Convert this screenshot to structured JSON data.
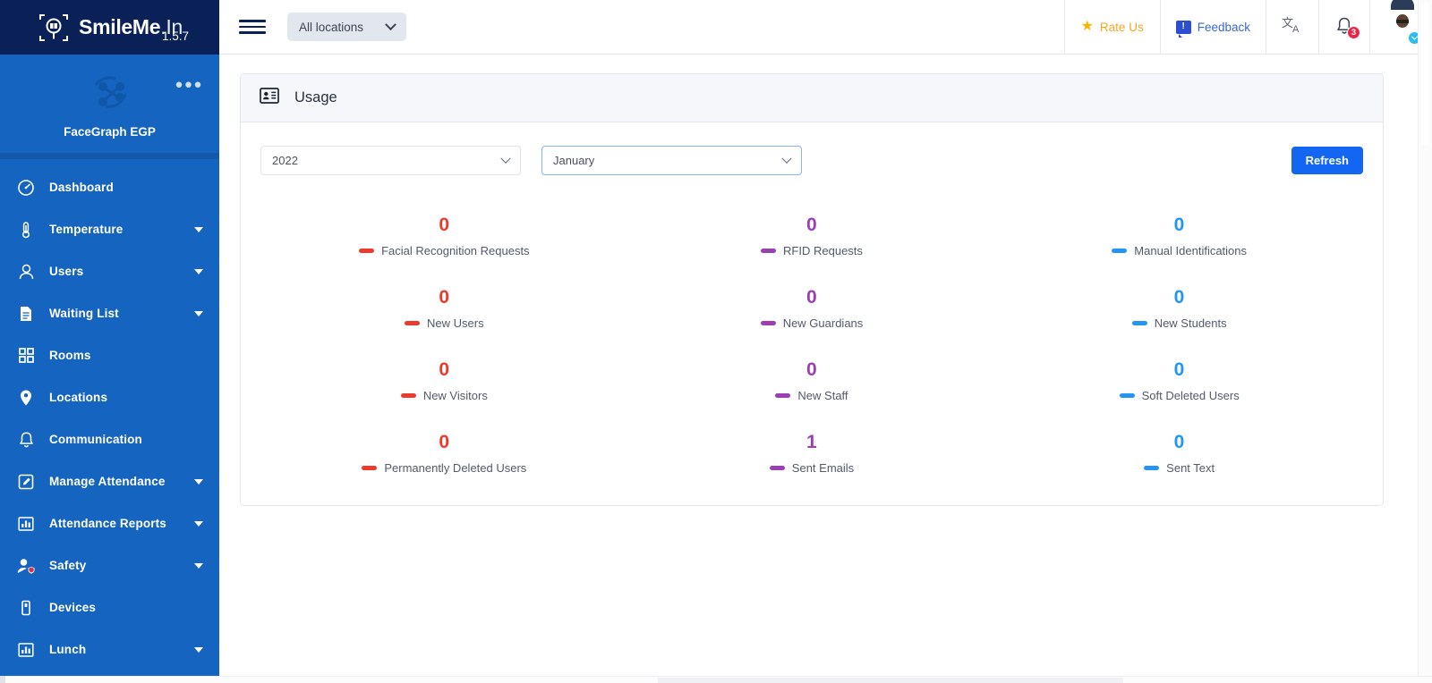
{
  "brand": {
    "name_bold": "SmileMe",
    "name_rest": ".In",
    "version": "1.5.7",
    "logo_icon": "face-scan-logo-icon"
  },
  "tenant": {
    "name": "FaceGraph EGP",
    "menu_icon": "ellipsis-icon",
    "logo_icon": "network-graph-icon"
  },
  "sidebar": {
    "items": [
      {
        "label": "Dashboard",
        "icon": "speedometer-icon",
        "expandable": false
      },
      {
        "label": "Temperature",
        "icon": "thermometer-icon",
        "expandable": true
      },
      {
        "label": "Users",
        "icon": "user-icon",
        "expandable": true
      },
      {
        "label": "Waiting List",
        "icon": "document-icon",
        "expandable": true
      },
      {
        "label": "Rooms",
        "icon": "grid-squares-icon",
        "expandable": false
      },
      {
        "label": "Locations",
        "icon": "map-pin-icon",
        "expandable": false
      },
      {
        "label": "Communication",
        "icon": "bell-icon",
        "expandable": false
      },
      {
        "label": "Manage Attendance",
        "icon": "edit-square-icon",
        "expandable": true
      },
      {
        "label": "Attendance Reports",
        "icon": "bar-chart-icon",
        "expandable": true
      },
      {
        "label": "Safety",
        "icon": "user-shield-icon",
        "expandable": true
      },
      {
        "label": "Devices",
        "icon": "mobile-device-icon",
        "expandable": false
      },
      {
        "label": "Lunch",
        "icon": "bar-chart-icon",
        "expandable": true
      }
    ]
  },
  "topbar": {
    "menu_icon": "hamburger-menu-icon",
    "location_filter": {
      "value": "All locations",
      "chevron_icon": "chevron-down-icon"
    },
    "rate_us": {
      "label": "Rate Us",
      "icon": "star-icon",
      "color": "#f5a623"
    },
    "feedback": {
      "label": "Feedback",
      "icon": "feedback-bubble-icon",
      "color": "#3867d6"
    },
    "translate": {
      "icon": "translate-icon"
    },
    "notifications": {
      "icon": "bell-icon",
      "count": "3",
      "badge_color": "#e8274b"
    },
    "account": {
      "icon": "avatar",
      "chevron_icon": "chevron-down-circle-icon"
    }
  },
  "card": {
    "title": "Usage",
    "icon": "id-card-icon",
    "filters": {
      "year": {
        "value": "2022",
        "chevron_icon": "chevron-down-icon"
      },
      "month": {
        "value": "January",
        "chevron_icon": "chevron-down-icon"
      }
    },
    "refresh_label": "Refresh",
    "refresh_color": "#1266f1"
  },
  "colors": {
    "red": "#ed3a2e",
    "purple": "#9b3fb5",
    "blue": "#2196f3"
  },
  "stats": [
    {
      "value": "0",
      "label": "Facial Recognition Requests",
      "color": "#ed3a2e"
    },
    {
      "value": "0",
      "label": "RFID Requests",
      "color": "#9b3fb5"
    },
    {
      "value": "0",
      "label": "Manual Identifications",
      "color": "#2196f3"
    },
    {
      "value": "0",
      "label": "New Users",
      "color": "#ed3a2e"
    },
    {
      "value": "0",
      "label": "New Guardians",
      "color": "#9b3fb5"
    },
    {
      "value": "0",
      "label": "New Students",
      "color": "#2196f3"
    },
    {
      "value": "0",
      "label": "New Visitors",
      "color": "#ed3a2e"
    },
    {
      "value": "0",
      "label": "New Staff",
      "color": "#9b3fb5"
    },
    {
      "value": "0",
      "label": "Soft Deleted Users",
      "color": "#2196f3"
    },
    {
      "value": "0",
      "label": "Permanently Deleted Users",
      "color": "#ed3a2e"
    },
    {
      "value": "1",
      "label": "Sent Emails",
      "color": "#9b3fb5"
    },
    {
      "value": "0",
      "label": "Sent Text",
      "color": "#2196f3"
    }
  ]
}
